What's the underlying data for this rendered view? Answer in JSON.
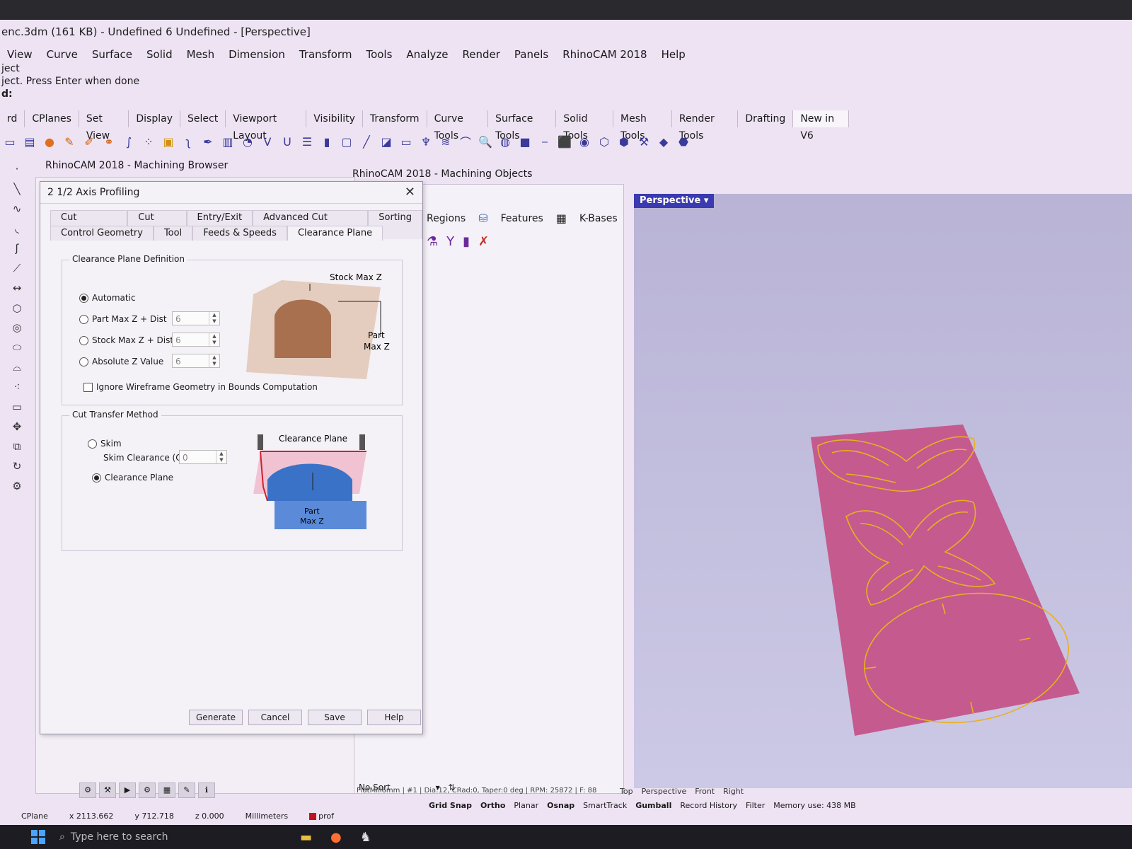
{
  "window": {
    "title": "enc.3dm (161 KB) - Undefined 6 Undefined - [Perspective]"
  },
  "menu": [
    "View",
    "Curve",
    "Surface",
    "Solid",
    "Mesh",
    "Dimension",
    "Transform",
    "Tools",
    "Analyze",
    "Render",
    "Panels",
    "RhinoCAM 2018",
    "Help"
  ],
  "cmdline": [
    "ject",
    "ject. Press Enter when done",
    "d:"
  ],
  "toolbar_tabs": [
    "rd",
    "CPlanes",
    "Set View",
    "Display",
    "Select",
    "Viewport Layout",
    "Visibility",
    "Transform",
    "Curve Tools",
    "Surface Tools",
    "Solid Tools",
    "Mesh Tools",
    "Render Tools",
    "Drafting",
    "New in V6"
  ],
  "panels": {
    "browser_title": "RhinoCAM 2018 - Machining Browser",
    "objects_title": "RhinoCAM 2018 - Machining Objects"
  },
  "objects": {
    "tabs": [
      "Regions",
      "Features",
      "K-Bases"
    ],
    "sort_label": "No Sort"
  },
  "dialog": {
    "title": "2 1/2 Axis Profiling",
    "tabs_row1": [
      "Cut Parameters",
      "Cut Levels",
      "Entry/Exit",
      "Advanced Cut Parameters",
      "Sorting"
    ],
    "tabs_row2": [
      "Control Geometry",
      "Tool",
      "Feeds & Speeds",
      "Clearance Plane"
    ],
    "group1": {
      "title": "Clearance Plane Definition",
      "options": [
        "Automatic",
        "Part Max Z + Dist",
        "Stock Max Z + Dist",
        "Absolute Z Value"
      ],
      "values": [
        "6",
        "6",
        "6"
      ],
      "checkbox": "Ignore Wireframe Geometry in Bounds Computation",
      "diagram_labels": {
        "stock": "Stock Max Z",
        "part1": "Part",
        "part2": "Max Z"
      }
    },
    "group2": {
      "title": "Cut Transfer Method",
      "skim": "Skim",
      "skim_clearance": "Skim Clearance (C)",
      "skim_value": "0",
      "clearance_plane": "Clearance Plane",
      "diagram_labels": {
        "plane": "Clearance Plane",
        "part1": "Part",
        "part2": "Max Z"
      }
    },
    "buttons": [
      "Generate",
      "Cancel",
      "Save",
      "Help"
    ]
  },
  "viewport": {
    "label": "Perspective"
  },
  "status": {
    "tool_info": "FlatMill6mm | #1 | Dia:12, CRad:0, Taper:0 deg | RPM: 25872 | F: 88",
    "view_tabs": [
      "Top",
      "Perspective",
      "Front",
      "Right"
    ],
    "osnap": [
      "Grid Snap",
      "Ortho",
      "Planar",
      "Osnap",
      "SmartTrack",
      "Gumball",
      "Record History",
      "Filter",
      "Memory use: 438 MB"
    ],
    "cplane": "CPlane",
    "x": "x 2113.662",
    "y": "y 712.718",
    "z": "z 0.000",
    "units": "Millimeters",
    "layer": "prof"
  },
  "taskbar": {
    "search_placeholder": "Type here to search"
  },
  "colors": {
    "accent": "#3b3ab0",
    "part_fill": "#c55a8e",
    "toolpath": "#e8b020"
  }
}
